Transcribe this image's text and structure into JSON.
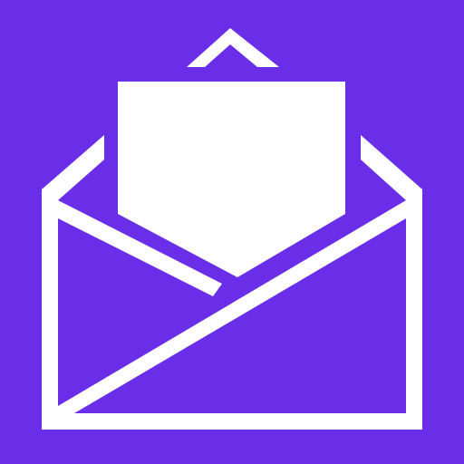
{
  "icon": {
    "name": "open-envelope-icon",
    "background_color": "#6a2ee8",
    "foreground_color": "#ffffff"
  }
}
